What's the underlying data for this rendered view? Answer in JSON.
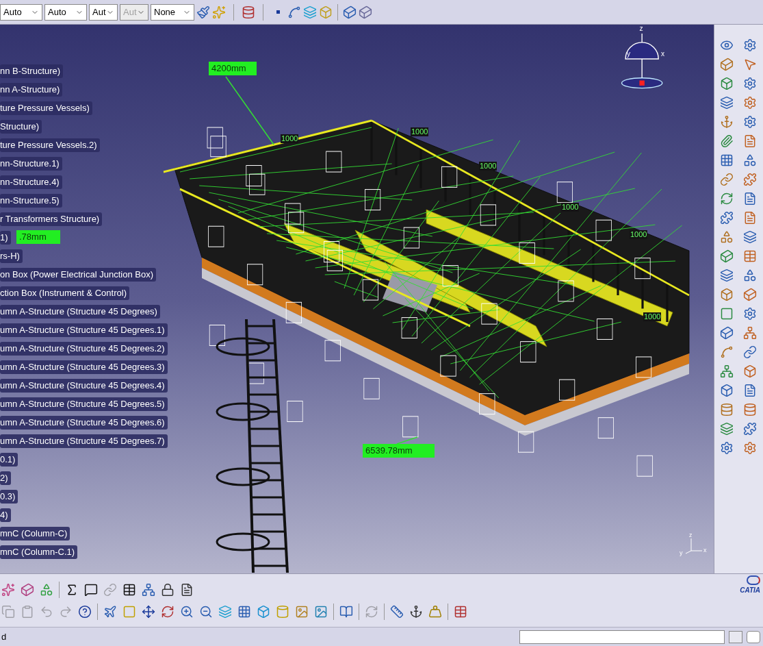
{
  "top_toolbar": {
    "dropdowns": [
      {
        "value": "Auto",
        "disabled": false
      },
      {
        "value": "Auto",
        "disabled": false
      },
      {
        "value": "Aut",
        "disabled": false
      },
      {
        "value": "Aut",
        "disabled": true
      },
      {
        "value": "None",
        "disabled": false
      }
    ]
  },
  "viewport": {
    "tree_items": [
      "nn B-Structure)",
      "nn A-Structure)",
      "ture Pressure Vessels)",
      "Structure)",
      "ture Pressure Vessels.2)",
      "nn-Structure.1)",
      "nn-Structure.4)",
      "nn-Structure.5)",
      "r Transformers Structure)",
      "1)",
      "rs-H)",
      "on Box (Power Electrical Junction Box)",
      "ction Box (Instrument & Control)",
      "umn A-Structure (Structure 45 Degrees)",
      "umn A-Structure (Structure 45 Degrees.1)",
      "umn A-Structure (Structure 45 Degrees.2)",
      "umn A-Structure (Structure 45 Degrees.3)",
      "umn A-Structure (Structure 45 Degrees.4)",
      "umn A-Structure (Structure 45 Degrees.5)",
      "umn A-Structure (Structure 45 Degrees.6)",
      "umn A-Structure (Structure 45 Degrees.7)",
      "0.1)",
      "2)",
      "0.3)",
      "4)",
      "mnC (Column-C)",
      "mnC (Column-C.1)"
    ],
    "dimension_labels": [
      "4200mm",
      ".78mm",
      "6539.78mm"
    ],
    "dimension_marks": [
      "1000",
      "1000",
      "1000",
      "1000",
      "1000",
      "1000"
    ],
    "compass_axes": [
      "z",
      "y",
      "x"
    ],
    "axis_triad": [
      "z",
      "x",
      "y"
    ]
  },
  "logo": {
    "text": "CATIA"
  },
  "status_bar": {
    "message": "d"
  }
}
